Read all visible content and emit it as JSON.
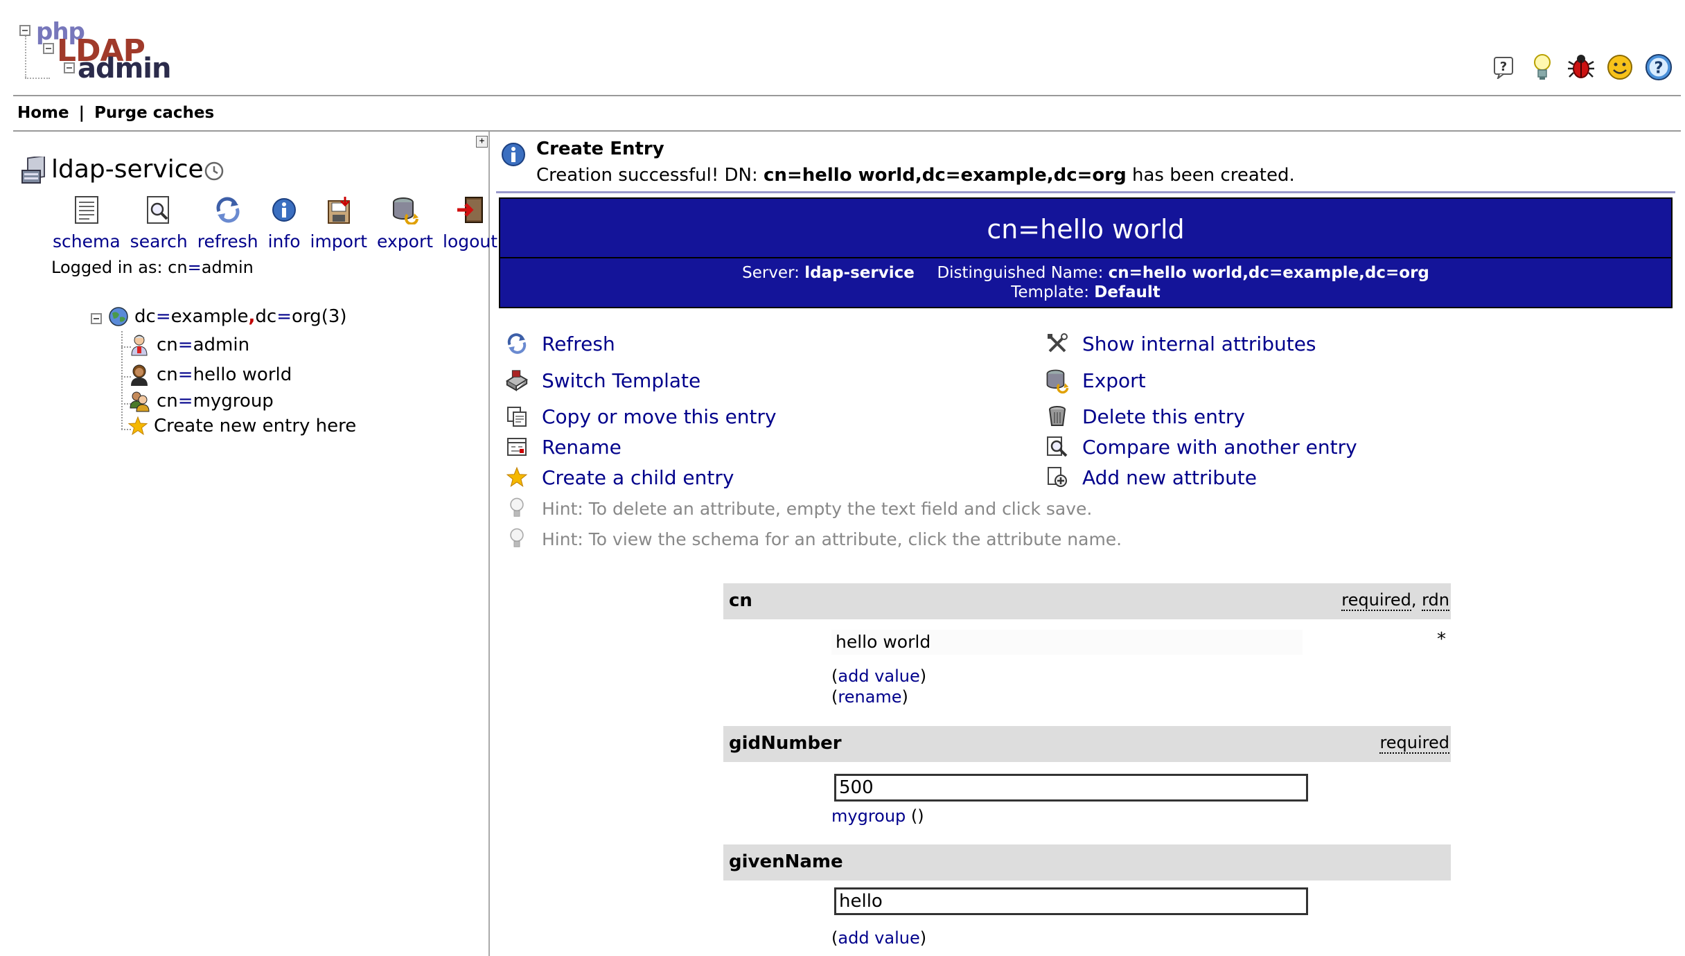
{
  "logo": {
    "php": "php",
    "ldap": "LDAP",
    "admin": "admin"
  },
  "top_icons": [
    "question-icon",
    "lightbulb-icon",
    "bug-icon",
    "smiley-icon",
    "help-icon"
  ],
  "nav": {
    "home": "Home",
    "separator": "|",
    "purge": "Purge caches"
  },
  "server": {
    "name": "ldap-service"
  },
  "toolbar": [
    {
      "label": "schema",
      "icon": "schema-icon"
    },
    {
      "label": "search",
      "icon": "search-icon"
    },
    {
      "label": "refresh",
      "icon": "refresh-icon"
    },
    {
      "label": "info",
      "icon": "info-icon"
    },
    {
      "label": "import",
      "icon": "import-icon"
    },
    {
      "label": "export",
      "icon": "export-icon"
    },
    {
      "label": "logout",
      "icon": "logout-icon"
    }
  ],
  "logged_in": {
    "prefix": "Logged in as: ",
    "user_attr": "cn",
    "eq": "=",
    "user_val": "admin"
  },
  "tree": {
    "root": {
      "a1": "dc",
      "v1": "example",
      "comma": ",",
      "a2": "dc",
      "v2": "org",
      "count": " (3)"
    },
    "children": [
      {
        "attr": "cn",
        "val": "admin"
      },
      {
        "attr": "cn",
        "val": "hello world"
      },
      {
        "attr": "cn",
        "val": "mygroup"
      }
    ],
    "create": "Create new entry here"
  },
  "message": {
    "title": "Create Entry",
    "body_prefix": "Creation successful! DN: ",
    "dn": "cn=hello world,dc=example,dc=org",
    "body_suffix": " has been created."
  },
  "entry": {
    "title": "cn=hello world",
    "server_label": "Server: ",
    "server_value": "ldap-service",
    "dn_label": "Distinguished Name: ",
    "dn_value": "cn=hello world,dc=example,dc=org",
    "template_label": "Template: ",
    "template_value": "Default"
  },
  "actions_left": [
    "Refresh",
    "Switch Template",
    "Copy or move this entry",
    "Rename",
    "Create a child entry"
  ],
  "actions_right": [
    "Show internal attributes",
    "Export",
    "Delete this entry",
    "Compare with another entry",
    "Add new attribute"
  ],
  "hints": [
    "Hint: To delete an attribute, empty the text field and click save.",
    "Hint: To view the schema for an attribute, click the attribute name."
  ],
  "attributes": {
    "cn": {
      "name": "cn",
      "flag1": "required",
      "flag_sep": ", ",
      "flag2": "rdn",
      "value": "hello world",
      "star": "*",
      "add_value": "add value",
      "rename": "rename"
    },
    "gidNumber": {
      "name": "gidNumber",
      "flag1": "required",
      "value": "500",
      "group_link": "mygroup",
      "group_paren": " ()"
    },
    "givenName": {
      "name": "givenName",
      "value": "hello",
      "add_value": "add value"
    }
  },
  "paren_open": "(",
  "paren_close": ")"
}
